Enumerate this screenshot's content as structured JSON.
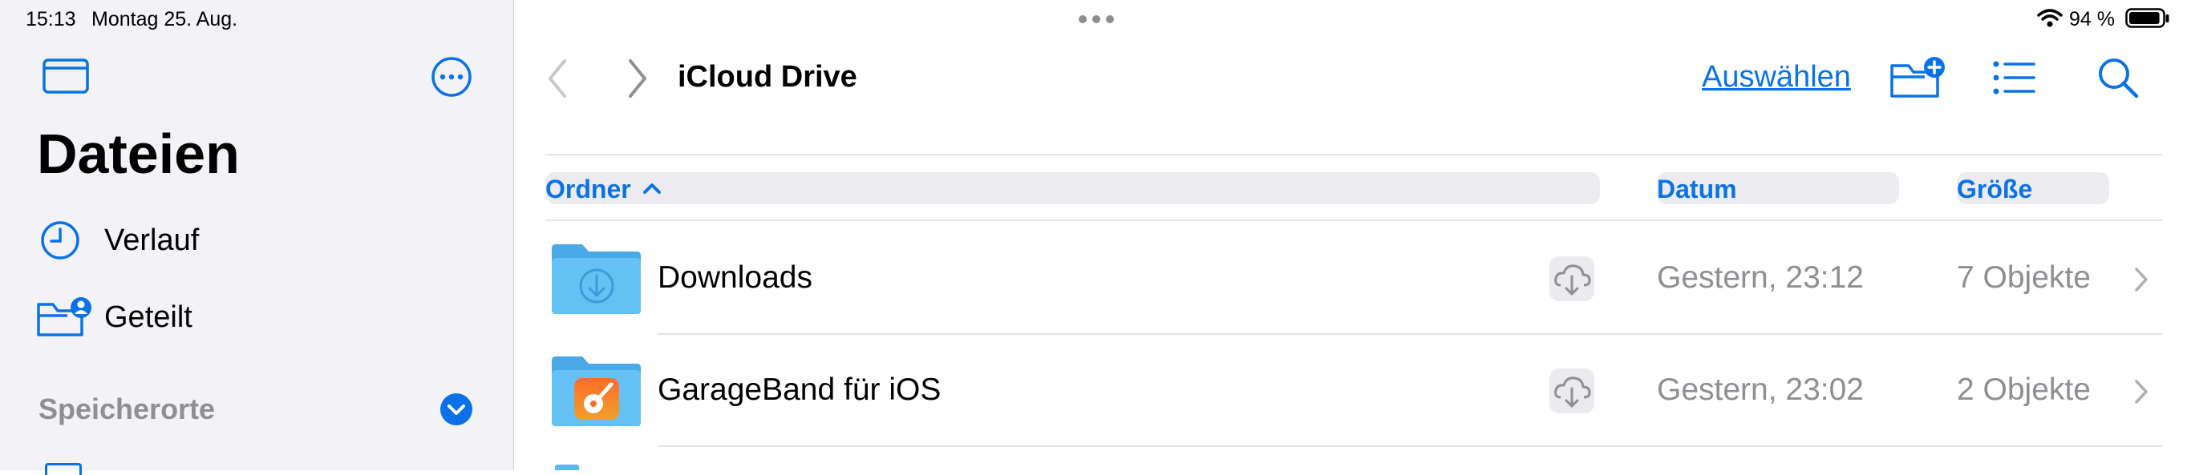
{
  "status_bar": {
    "time": "15:13",
    "date": "Montag 25. Aug.",
    "battery_percent": "94 %",
    "battery_level": 0.94
  },
  "sidebar": {
    "title": "Dateien",
    "items": [
      {
        "label": "Verlauf",
        "icon": "clock-icon"
      },
      {
        "label": "Geteilt",
        "icon": "shared-folder-icon"
      }
    ],
    "section_header": "Speicherorte",
    "icons": {
      "toggle": "sidebar-toggle-icon",
      "more": "ellipsis-circle-icon",
      "expand": "chevron-down-circle-icon"
    }
  },
  "toolbar": {
    "title": "iCloud Drive",
    "select_label": "Auswählen",
    "icons": [
      "back-chevron-icon",
      "forward-chevron-icon",
      "new-folder-icon",
      "list-view-icon",
      "search-icon"
    ]
  },
  "table": {
    "columns": {
      "name": "Ordner",
      "date": "Datum",
      "size": "Größe"
    },
    "sort": "ascending",
    "rows": [
      {
        "name": "Downloads",
        "date": "Gestern, 23:12",
        "size": "7 Objekte",
        "icon": "downloads-folder-icon"
      },
      {
        "name": "GarageBand für iOS",
        "date": "Gestern, 23:02",
        "size": "2 Objekte",
        "icon": "garageband-folder-icon"
      }
    ]
  },
  "colors": {
    "accent": "#0a72e6",
    "sidebar_bg": "#f2f2f7",
    "folder": "#5ab8ee"
  }
}
